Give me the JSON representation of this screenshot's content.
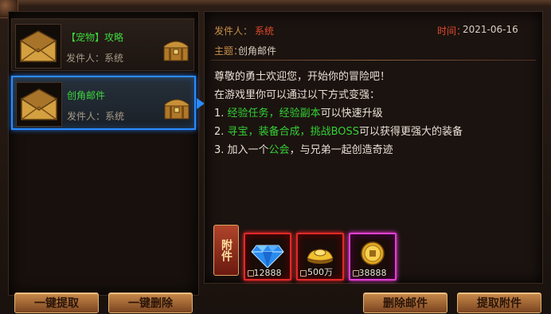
{
  "mail_list": [
    {
      "title": "【宠物】攻略",
      "sender_label": "发件人：",
      "sender": "系统",
      "selected": false
    },
    {
      "title": "创角邮件",
      "sender_label": "发件人：",
      "sender": "系统",
      "selected": true
    }
  ],
  "detail": {
    "sender_label": "发件人：",
    "sender": "系统",
    "time_label": "时间：",
    "time": "2021-06-16",
    "subject_label": "主题：",
    "subject": "创角邮件",
    "body": {
      "line1": "尊敬的勇士欢迎您，开始你的冒险吧！",
      "line2": "在游戏里你可以通过以下方式变强：",
      "line3": {
        "prefix": "1. ",
        "hl1": "经验任务",
        "sep1": "，",
        "hl2": "经验副本",
        "suffix": "可以快速升级"
      },
      "line4": {
        "prefix": "2. ",
        "hl1": "寻宝",
        "sep1": "，",
        "hl2": "装备合成",
        "sep2": "，",
        "hl3": "挑战BOSS",
        "suffix": "可以获得更强大的装备"
      },
      "line5": {
        "prefix": "3. 加入一个",
        "hl1": "公会",
        "suffix": "，与兄弟一起创造奇迹"
      }
    }
  },
  "attachments": {
    "label": "附件",
    "items": [
      {
        "icon": "diamond-icon",
        "quantity": "12888",
        "rarity": "red"
      },
      {
        "icon": "gold-ingot-icon",
        "quantity": "500万",
        "rarity": "red"
      },
      {
        "icon": "gold-coin-icon",
        "quantity": "38888",
        "rarity": "purple"
      }
    ]
  },
  "buttons": {
    "claim_all": "一键提取",
    "delete_all": "一键删除",
    "delete_mail": "删除邮件",
    "claim_attachment": "提取附件"
  },
  "colors": {
    "highlight_green": "#34d034",
    "selected_border": "#2a8bff",
    "label_orange": "#c89048",
    "value_red": "#e04a2a"
  }
}
